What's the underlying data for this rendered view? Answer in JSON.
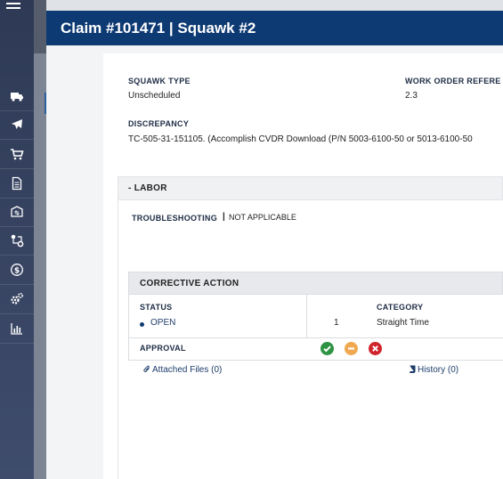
{
  "header": {
    "title": "Claim #101471 | Squawk #2"
  },
  "squawk": {
    "type_label": "SQUAWK TYPE",
    "type_value": "Unscheduled",
    "work_order_label": "WORK ORDER REFERE",
    "work_order_value": "2.3",
    "discrepancy_label": "DISCREPANCY",
    "discrepancy_value": "TC-505-31-151105. (Accomplish CVDR Download (P/N 5003-6100-50 or 5013-6100-50"
  },
  "labor": {
    "header": "- LABOR",
    "troubleshooting_label": "TROUBLESHOOTING",
    "troubleshooting_sep": "|",
    "troubleshooting_value": "NOT APPLICABLE"
  },
  "corrective_action": {
    "header": "CORRECTIVE ACTION",
    "status_label": "STATUS",
    "status_value": "OPEN",
    "quantity": "1",
    "category_label": "CATEGORY",
    "category_value": "Straight Time",
    "approval_label": "APPROVAL"
  },
  "approval_colors": {
    "approve": "#2e9443",
    "hold": "#f0a950",
    "reject": "#d0242c"
  },
  "links": {
    "attached_files": "Attached Files (0)",
    "history": "History (0)"
  },
  "sidebar_icons": [
    "truck-icon",
    "plane-icon",
    "cart-icon",
    "document-icon",
    "box-exchange-icon",
    "network-settings-icon",
    "dollar-icon",
    "gears-icon",
    "bar-chart-icon"
  ],
  "colors": {
    "header_bg": "#0e3a73",
    "sidebar_bg": "#2e3a55"
  }
}
